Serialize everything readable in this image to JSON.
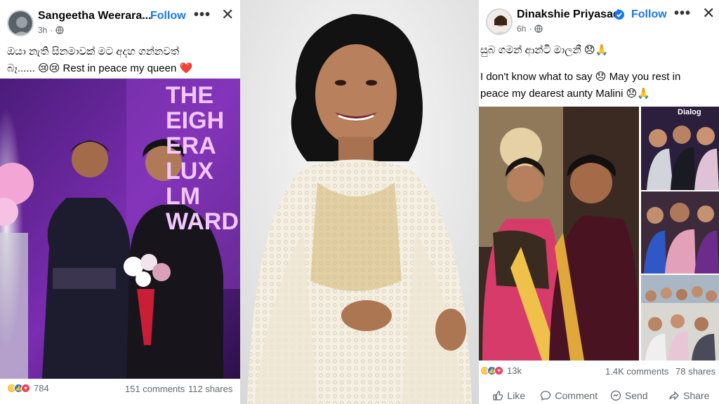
{
  "left_post": {
    "author": "Sangeetha Weerara...",
    "follow_label": "Follow",
    "time": "3h",
    "text_line1": "ඔයා නැති සිනමාවක් මට අදහ ගන්නවත්",
    "text_line2": "බෑ...... 😢😢 Rest in peace my queen ❤️",
    "banner_text": [
      "THE",
      "EIGH",
      "ERA",
      "LUX",
      "LM",
      "WARD"
    ],
    "reaction_count": "784",
    "comments": "151 comments",
    "shares": "112 shares"
  },
  "right_post": {
    "author": "Dinakshie Priyasad",
    "follow_label": "Follow",
    "time": "6h",
    "text_line1": "සුබ ගමන් ආන්ටි මාලනී 😞🙏",
    "text_line2": "I don't know what to say 😞 May you rest in",
    "text_line3": "peace my dearest aunty Malini 😞🙏",
    "dialog_text": "Dialog",
    "reaction_count": "13k",
    "comments": "1.4K comments",
    "shares": "78 shares",
    "actions": {
      "like": "Like",
      "comment": "Comment",
      "send": "Send",
      "share": "Share"
    }
  },
  "colors": {
    "follow_blue": "#1877f2",
    "meta_gray": "#65676b",
    "purple_stage": "#7a2db0"
  },
  "icons": [
    "globe-icon",
    "more-options-icon",
    "close-icon",
    "verified-badge-icon",
    "like-icon",
    "comment-icon",
    "send-icon",
    "share-icon"
  ]
}
